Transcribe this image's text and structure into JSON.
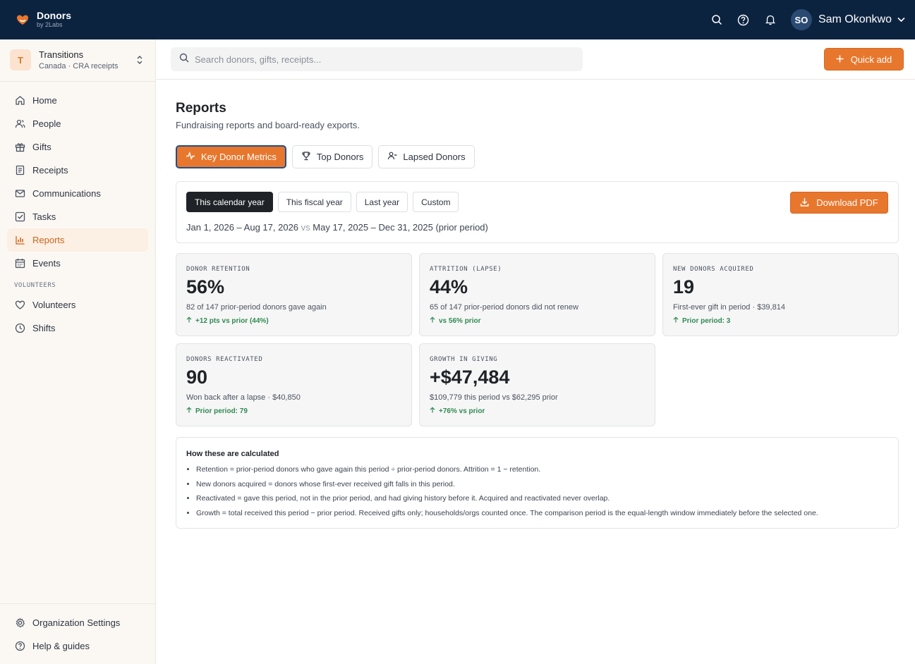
{
  "app": {
    "name": "Donors",
    "byline": "by 2Labs"
  },
  "user": {
    "initials": "SO",
    "name": "Sam Okonkwo"
  },
  "org": {
    "initial": "T",
    "name": "Transitions",
    "subtitle": "Canada · CRA receipts"
  },
  "sidebar": {
    "items": [
      {
        "label": "Home",
        "icon": "home-icon"
      },
      {
        "label": "People",
        "icon": "people-icon"
      },
      {
        "label": "Gifts",
        "icon": "gift-icon"
      },
      {
        "label": "Receipts",
        "icon": "receipt-icon"
      },
      {
        "label": "Communications",
        "icon": "mail-icon"
      },
      {
        "label": "Tasks",
        "icon": "checkbox-icon"
      },
      {
        "label": "Reports",
        "icon": "bar-chart-icon",
        "active": true
      },
      {
        "label": "Events",
        "icon": "calendar-icon"
      }
    ],
    "section_volunteers": "VOLUNTEERS",
    "volunteer_items": [
      {
        "label": "Volunteers",
        "icon": "heart-icon"
      },
      {
        "label": "Shifts",
        "icon": "clock-icon"
      }
    ],
    "bottom_items": [
      {
        "label": "Organization Settings",
        "icon": "gear-icon"
      },
      {
        "label": "Help & guides",
        "icon": "help-icon"
      }
    ]
  },
  "search": {
    "placeholder": "Search donors, gifts, receipts..."
  },
  "quick_add": {
    "label": "Quick add"
  },
  "page": {
    "title": "Reports",
    "subtitle": "Fundraising reports and board-ready exports."
  },
  "tabs": [
    {
      "label": "Key Donor Metrics",
      "active": true
    },
    {
      "label": "Top Donors"
    },
    {
      "label": "Lapsed Donors"
    }
  ],
  "ranges": [
    {
      "label": "This calendar year",
      "active": true
    },
    {
      "label": "This fiscal year"
    },
    {
      "label": "Last year"
    },
    {
      "label": "Custom"
    }
  ],
  "download": {
    "label": "Download PDF"
  },
  "period": {
    "current": "Jan 1, 2026 – Aug 17, 2026",
    "vs": "vs",
    "prior": "May 17, 2025 – Dec 31, 2025 (prior period)"
  },
  "metrics": [
    {
      "label": "DONOR RETENTION",
      "value": "56%",
      "desc": "82 of 147 prior-period donors gave again",
      "delta": "+12 pts vs prior (44%)"
    },
    {
      "label": "ATTRITION (LAPSE)",
      "value": "44%",
      "desc": "65 of 147 prior-period donors did not renew",
      "delta": "vs 56% prior"
    },
    {
      "label": "NEW DONORS ACQUIRED",
      "value": "19",
      "desc": "First-ever gift in period · $39,814",
      "delta": "Prior period: 3"
    },
    {
      "label": "DONORS REACTIVATED",
      "value": "90",
      "desc": "Won back after a lapse · $40,850",
      "delta": "Prior period: 79"
    },
    {
      "label": "GROWTH IN GIVING",
      "value": "+$47,484",
      "desc": "$109,779 this period vs $62,295 prior",
      "delta": "+76% vs prior"
    }
  ],
  "notes": {
    "title": "How these are calculated",
    "items": [
      "Retention = prior-period donors who gave again this period ÷ prior-period donors. Attrition = 1 − retention.",
      "New donors acquired = donors whose first-ever received gift falls in this period.",
      "Reactivated = gave this period, not in the prior period, and had giving history before it. Acquired and reactivated never overlap.",
      "Growth = total received this period − prior period. Received gifts only; households/orgs counted once. The comparison period is the equal-length window immediately before the selected one."
    ]
  },
  "colors": {
    "topbar": "#0c2340",
    "accent": "#e8772e",
    "positive": "#2f8a52"
  }
}
